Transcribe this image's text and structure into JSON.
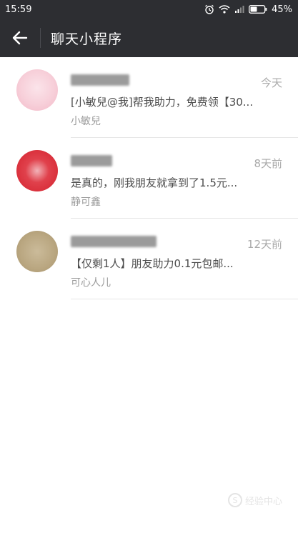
{
  "status_bar": {
    "time": "15:59",
    "battery_percent": "45%",
    "icons": [
      "alarm-icon",
      "wifi-icon",
      "signal-icon",
      "battery-icon"
    ]
  },
  "header": {
    "title": "聊天小程序",
    "back_icon": "arrow-left-icon"
  },
  "chats": [
    {
      "time": "今天",
      "preview": "[小敏兒@我]帮我助力，免费领【30...",
      "sender": "小敏兒",
      "avatar_color": "#f5c6d2"
    },
    {
      "time": "8天前",
      "preview": "是真的，刚我朋友就拿到了1.5元...",
      "sender": "静可鑫",
      "avatar_color": "#d6232f"
    },
    {
      "time": "12天前",
      "preview": "【仅剩1人】朋友助力0.1元包邮...",
      "sender": "可心人儿",
      "avatar_color": "#b9a680"
    }
  ],
  "watermark": {
    "icon": "s-logo-icon",
    "text": "经验中心"
  },
  "colors": {
    "header_bg": "#2d2e32",
    "time_text": "#a9a9a9",
    "preview_text": "#4c4c4c",
    "sender_text": "#9b9b9b"
  }
}
